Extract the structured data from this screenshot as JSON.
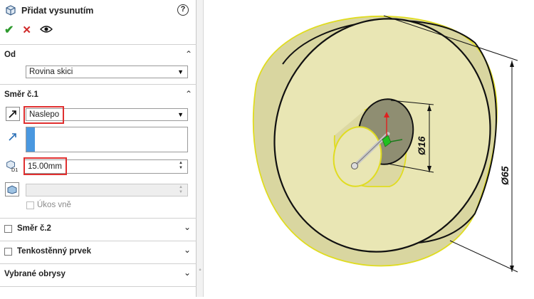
{
  "panel": {
    "title": "Přidat vysunutím",
    "help": "?",
    "actions": {
      "ok": "✔",
      "cancel": "✕"
    }
  },
  "sections": {
    "od": {
      "label": "Od",
      "dropdown": "Rovina skici"
    },
    "smer1": {
      "label": "Směr č.1",
      "type_dropdown": "Naslepo",
      "depth": "15.00mm",
      "draft_label": "Úkos vně"
    },
    "smer2": {
      "label": "Směr č.2"
    },
    "tenkostenny": {
      "label": "Tenkostěnný prvek"
    },
    "vybrane": {
      "label": "Vybrané obrysy"
    }
  },
  "dimensions": {
    "small": "Ø16",
    "large": "Ø65"
  },
  "colors": {
    "part_face": "#e9e6b4",
    "part_side": "#c9c58e",
    "edge_highlight": "#f0ea1a",
    "highlight_box": "#e03030",
    "selection_accent": "#4a98e0"
  }
}
